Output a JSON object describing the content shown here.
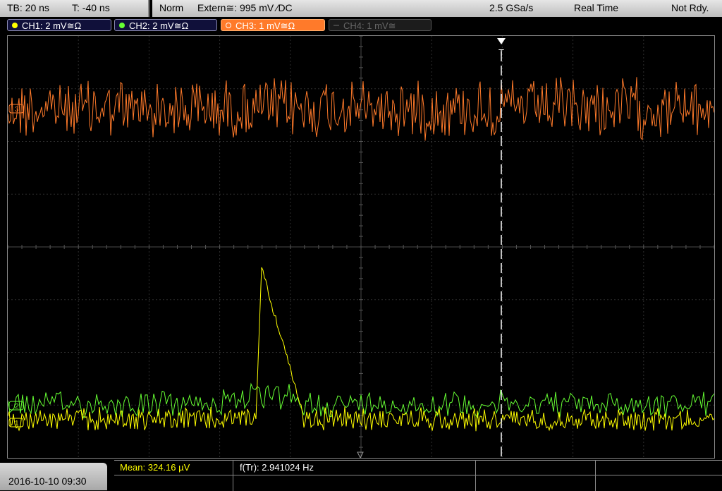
{
  "topbar": {
    "timebase": "TB: 20 ns",
    "trigger_time": "T: -40 ns",
    "trigger_mode": "Norm",
    "trigger_source": "Extern≅: 995 mV ⁄DC",
    "sample_rate": "2.5 GSa/s",
    "acq_mode": "Real Time",
    "status": "Not Rdy."
  },
  "channels": [
    {
      "label": "CH1: 2 mV≅Ω",
      "color": "#ffff00"
    },
    {
      "label": "CH2: 2 mV≅Ω",
      "color": "#66ff33"
    },
    {
      "label": "CH3: 1 mV≅Ω",
      "color": "#ff7a2a"
    },
    {
      "label": "CH4: 1 mV≅",
      "color": "#555555"
    }
  ],
  "screen": {
    "trigger_marker": "T",
    "ch3_marker": "3",
    "ch2_marker": "2",
    "ch1_marker": "1"
  },
  "footer": {
    "datetime": "2016-10-10 09:30",
    "measurement1": "Mean: 324.16 µV",
    "measurement2": "f(Tr): 2.941024 Hz"
  }
}
